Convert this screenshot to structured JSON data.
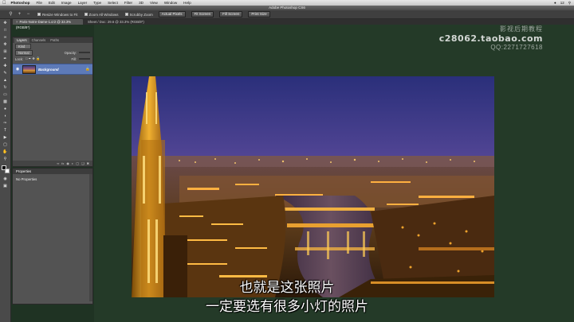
{
  "menubar": {
    "items": [
      "Photoshop",
      "File",
      "Edit",
      "Image",
      "Layer",
      "Type",
      "Select",
      "Filter",
      "3D",
      "View",
      "Window",
      "Help"
    ],
    "time": "12"
  },
  "window": {
    "title": "Adobe Photoshop CS6"
  },
  "options": {
    "resize_label": "Resize Windows to Fit",
    "zoom_all_label": "Zoom All Windows",
    "scrubby_label": "Scrubby Zoom",
    "actual_pixels": "Actual Pixels",
    "fit_screen": "Fit Screen",
    "fill_screen": "Fill Screen",
    "print_size": "Print Size"
  },
  "document": {
    "tab_active": "Paris-Notre-Dame-1.cr2 @ 33.3% (RGB/8*)",
    "tab_second": "Sheet / Doc: 29.6 @ 33.3% (RGB/8*)"
  },
  "layers_panel": {
    "tabs": [
      "Layers",
      "Channels",
      "Paths"
    ],
    "kind": "Kind",
    "blend_mode": "Normal",
    "opacity_label": "Opacity:",
    "lock_label": "Lock:",
    "fill_label": "Fill:",
    "layer_name": "Background"
  },
  "properties_panel": {
    "title": "Properties",
    "body": "No Properties"
  },
  "watermark": {
    "line1": "影视后期教程",
    "line2": "c28062.taobao.com",
    "line3": "QQ:2271727618"
  },
  "subtitles": {
    "line1": "也就是这张照片",
    "line2": "一定要选有很多小灯的照片"
  },
  "colors": {
    "canvas_bg": "#243a28",
    "selected_layer": "#5d7ab8",
    "panel_bg": "#535353"
  }
}
